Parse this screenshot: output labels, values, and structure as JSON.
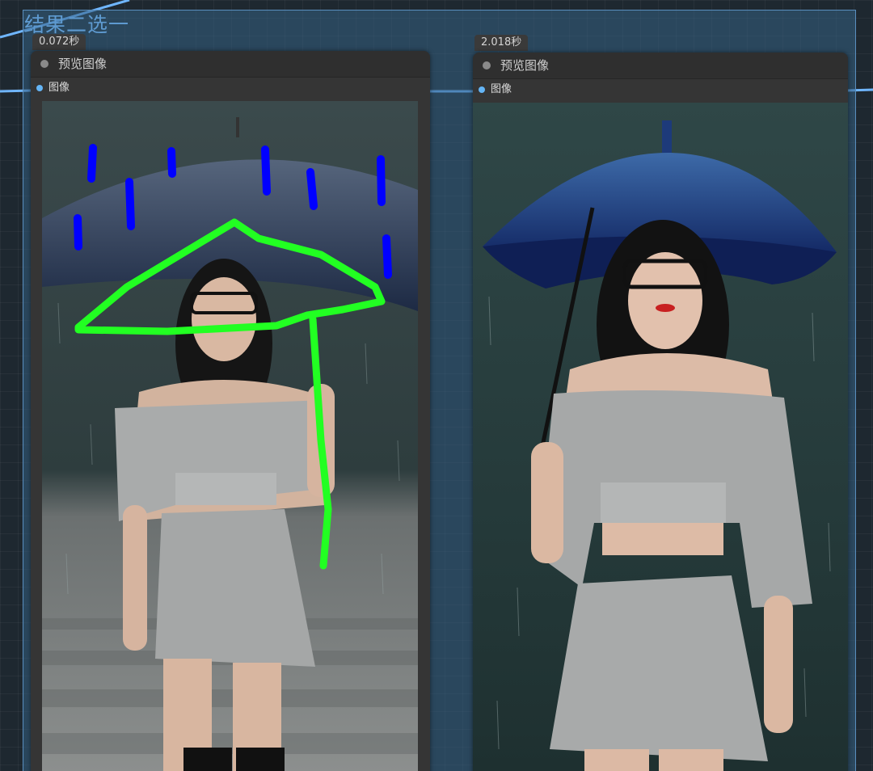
{
  "group": {
    "title": "结果二选一"
  },
  "nodes": [
    {
      "timing": "0.072秒",
      "title": "预览图像",
      "slot_label": "图像",
      "image_icon": "preview-image-with-sketch-icon"
    },
    {
      "timing": "2.018秒",
      "title": "预览图像",
      "slot_label": "图像",
      "image_icon": "preview-image-icon"
    }
  ],
  "colors": {
    "canvas": "#1e2830",
    "group_fill": "#346084",
    "node_body": "#353535",
    "slot_dot": "#64b5f6",
    "link": "#6fb6ff",
    "sketch_green": "#22ff22",
    "sketch_blue": "#0000ff"
  }
}
